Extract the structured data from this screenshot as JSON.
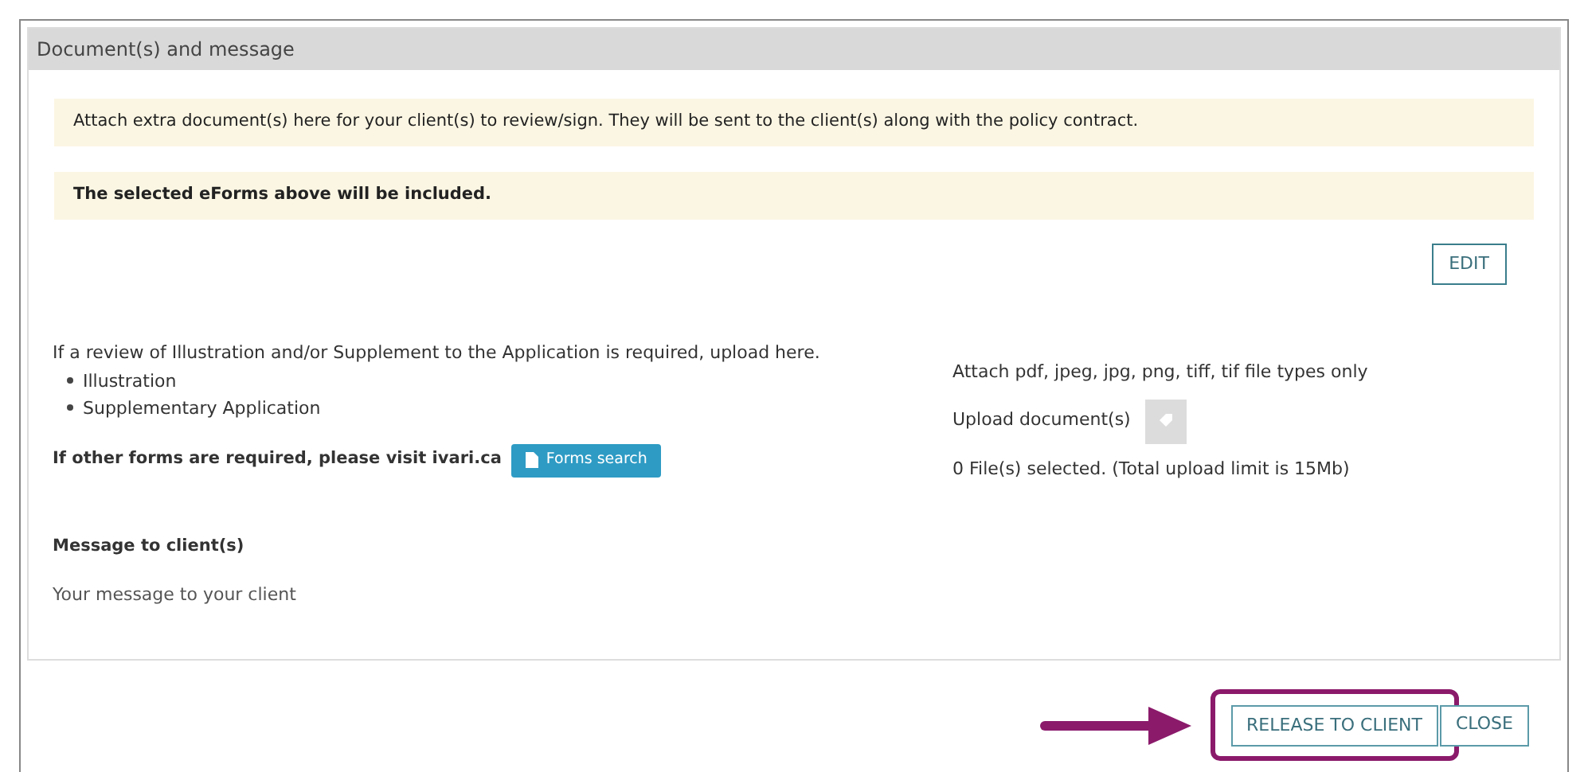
{
  "panel": {
    "title": "Document(s) and message"
  },
  "notices": [
    {
      "text": "Attach extra document(s) here for your client(s) to review/sign. They will be sent to the client(s) along with the policy contract.",
      "bold": false
    },
    {
      "text": "The selected eForms above will be included.",
      "bold": true
    }
  ],
  "edit_button": "EDIT",
  "review": {
    "intro": "If a review of Illustration and/or Supplement to the Application is required, upload here.",
    "items": [
      "Illustration",
      "Supplementary Application"
    ],
    "other_forms": "If other forms are required, please visit ivari.ca",
    "forms_button": "Forms search"
  },
  "upload": {
    "file_types": "Attach pdf, jpeg, jpg, png, tiff, tif file types only",
    "label": "Upload document(s)",
    "disabled": true,
    "status": "0 File(s) selected. (Total upload limit is 15Mb)"
  },
  "message": {
    "label": "Message to client(s)",
    "placeholder": "Your message to your client"
  },
  "buttons": [
    {
      "label": "RELEASE TO CLIENT",
      "highlighted": true
    },
    {
      "label": "CLOSE",
      "highlighted": false
    }
  ]
}
